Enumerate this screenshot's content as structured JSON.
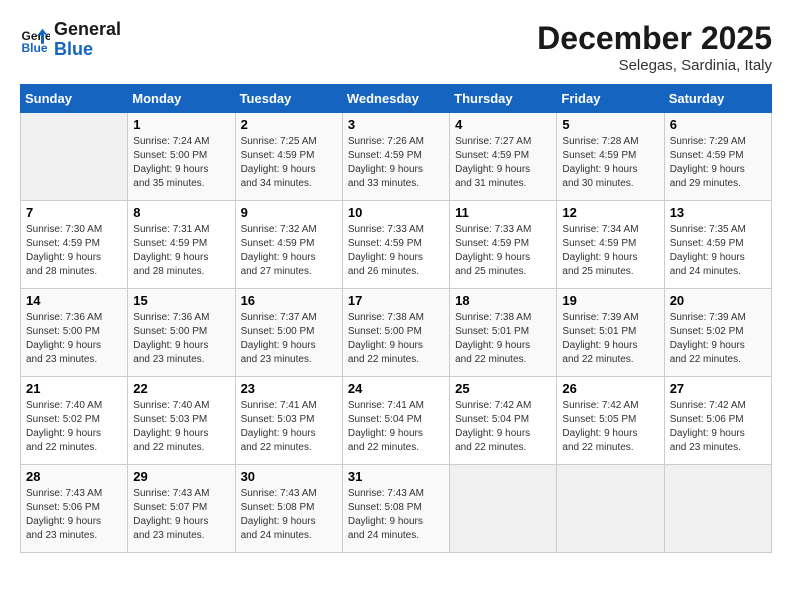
{
  "logo": {
    "line1": "General",
    "line2": "Blue"
  },
  "title": "December 2025",
  "subtitle": "Selegas, Sardinia, Italy",
  "weekdays": [
    "Sunday",
    "Monday",
    "Tuesday",
    "Wednesday",
    "Thursday",
    "Friday",
    "Saturday"
  ],
  "weeks": [
    [
      {
        "day": "",
        "info": ""
      },
      {
        "day": "1",
        "info": "Sunrise: 7:24 AM\nSunset: 5:00 PM\nDaylight: 9 hours\nand 35 minutes."
      },
      {
        "day": "2",
        "info": "Sunrise: 7:25 AM\nSunset: 4:59 PM\nDaylight: 9 hours\nand 34 minutes."
      },
      {
        "day": "3",
        "info": "Sunrise: 7:26 AM\nSunset: 4:59 PM\nDaylight: 9 hours\nand 33 minutes."
      },
      {
        "day": "4",
        "info": "Sunrise: 7:27 AM\nSunset: 4:59 PM\nDaylight: 9 hours\nand 31 minutes."
      },
      {
        "day": "5",
        "info": "Sunrise: 7:28 AM\nSunset: 4:59 PM\nDaylight: 9 hours\nand 30 minutes."
      },
      {
        "day": "6",
        "info": "Sunrise: 7:29 AM\nSunset: 4:59 PM\nDaylight: 9 hours\nand 29 minutes."
      }
    ],
    [
      {
        "day": "7",
        "info": "Sunrise: 7:30 AM\nSunset: 4:59 PM\nDaylight: 9 hours\nand 28 minutes."
      },
      {
        "day": "8",
        "info": "Sunrise: 7:31 AM\nSunset: 4:59 PM\nDaylight: 9 hours\nand 28 minutes."
      },
      {
        "day": "9",
        "info": "Sunrise: 7:32 AM\nSunset: 4:59 PM\nDaylight: 9 hours\nand 27 minutes."
      },
      {
        "day": "10",
        "info": "Sunrise: 7:33 AM\nSunset: 4:59 PM\nDaylight: 9 hours\nand 26 minutes."
      },
      {
        "day": "11",
        "info": "Sunrise: 7:33 AM\nSunset: 4:59 PM\nDaylight: 9 hours\nand 25 minutes."
      },
      {
        "day": "12",
        "info": "Sunrise: 7:34 AM\nSunset: 4:59 PM\nDaylight: 9 hours\nand 25 minutes."
      },
      {
        "day": "13",
        "info": "Sunrise: 7:35 AM\nSunset: 4:59 PM\nDaylight: 9 hours\nand 24 minutes."
      }
    ],
    [
      {
        "day": "14",
        "info": "Sunrise: 7:36 AM\nSunset: 5:00 PM\nDaylight: 9 hours\nand 23 minutes."
      },
      {
        "day": "15",
        "info": "Sunrise: 7:36 AM\nSunset: 5:00 PM\nDaylight: 9 hours\nand 23 minutes."
      },
      {
        "day": "16",
        "info": "Sunrise: 7:37 AM\nSunset: 5:00 PM\nDaylight: 9 hours\nand 23 minutes."
      },
      {
        "day": "17",
        "info": "Sunrise: 7:38 AM\nSunset: 5:00 PM\nDaylight: 9 hours\nand 22 minutes."
      },
      {
        "day": "18",
        "info": "Sunrise: 7:38 AM\nSunset: 5:01 PM\nDaylight: 9 hours\nand 22 minutes."
      },
      {
        "day": "19",
        "info": "Sunrise: 7:39 AM\nSunset: 5:01 PM\nDaylight: 9 hours\nand 22 minutes."
      },
      {
        "day": "20",
        "info": "Sunrise: 7:39 AM\nSunset: 5:02 PM\nDaylight: 9 hours\nand 22 minutes."
      }
    ],
    [
      {
        "day": "21",
        "info": "Sunrise: 7:40 AM\nSunset: 5:02 PM\nDaylight: 9 hours\nand 22 minutes."
      },
      {
        "day": "22",
        "info": "Sunrise: 7:40 AM\nSunset: 5:03 PM\nDaylight: 9 hours\nand 22 minutes."
      },
      {
        "day": "23",
        "info": "Sunrise: 7:41 AM\nSunset: 5:03 PM\nDaylight: 9 hours\nand 22 minutes."
      },
      {
        "day": "24",
        "info": "Sunrise: 7:41 AM\nSunset: 5:04 PM\nDaylight: 9 hours\nand 22 minutes."
      },
      {
        "day": "25",
        "info": "Sunrise: 7:42 AM\nSunset: 5:04 PM\nDaylight: 9 hours\nand 22 minutes."
      },
      {
        "day": "26",
        "info": "Sunrise: 7:42 AM\nSunset: 5:05 PM\nDaylight: 9 hours\nand 22 minutes."
      },
      {
        "day": "27",
        "info": "Sunrise: 7:42 AM\nSunset: 5:06 PM\nDaylight: 9 hours\nand 23 minutes."
      }
    ],
    [
      {
        "day": "28",
        "info": "Sunrise: 7:43 AM\nSunset: 5:06 PM\nDaylight: 9 hours\nand 23 minutes."
      },
      {
        "day": "29",
        "info": "Sunrise: 7:43 AM\nSunset: 5:07 PM\nDaylight: 9 hours\nand 23 minutes."
      },
      {
        "day": "30",
        "info": "Sunrise: 7:43 AM\nSunset: 5:08 PM\nDaylight: 9 hours\nand 24 minutes."
      },
      {
        "day": "31",
        "info": "Sunrise: 7:43 AM\nSunset: 5:08 PM\nDaylight: 9 hours\nand 24 minutes."
      },
      {
        "day": "",
        "info": ""
      },
      {
        "day": "",
        "info": ""
      },
      {
        "day": "",
        "info": ""
      }
    ]
  ]
}
